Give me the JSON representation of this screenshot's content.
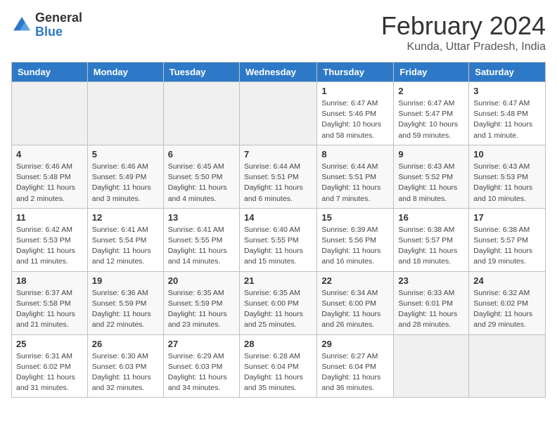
{
  "logo": {
    "general": "General",
    "blue": "Blue"
  },
  "header": {
    "month_year": "February 2024",
    "location": "Kunda, Uttar Pradesh, India"
  },
  "days_of_week": [
    "Sunday",
    "Monday",
    "Tuesday",
    "Wednesday",
    "Thursday",
    "Friday",
    "Saturday"
  ],
  "weeks": [
    [
      {
        "day": "",
        "info": ""
      },
      {
        "day": "",
        "info": ""
      },
      {
        "day": "",
        "info": ""
      },
      {
        "day": "",
        "info": ""
      },
      {
        "day": "1",
        "info": "Sunrise: 6:47 AM\nSunset: 5:46 PM\nDaylight: 10 hours and 58 minutes."
      },
      {
        "day": "2",
        "info": "Sunrise: 6:47 AM\nSunset: 5:47 PM\nDaylight: 10 hours and 59 minutes."
      },
      {
        "day": "3",
        "info": "Sunrise: 6:47 AM\nSunset: 5:48 PM\nDaylight: 11 hours and 1 minute."
      }
    ],
    [
      {
        "day": "4",
        "info": "Sunrise: 6:46 AM\nSunset: 5:48 PM\nDaylight: 11 hours and 2 minutes."
      },
      {
        "day": "5",
        "info": "Sunrise: 6:46 AM\nSunset: 5:49 PM\nDaylight: 11 hours and 3 minutes."
      },
      {
        "day": "6",
        "info": "Sunrise: 6:45 AM\nSunset: 5:50 PM\nDaylight: 11 hours and 4 minutes."
      },
      {
        "day": "7",
        "info": "Sunrise: 6:44 AM\nSunset: 5:51 PM\nDaylight: 11 hours and 6 minutes."
      },
      {
        "day": "8",
        "info": "Sunrise: 6:44 AM\nSunset: 5:51 PM\nDaylight: 11 hours and 7 minutes."
      },
      {
        "day": "9",
        "info": "Sunrise: 6:43 AM\nSunset: 5:52 PM\nDaylight: 11 hours and 8 minutes."
      },
      {
        "day": "10",
        "info": "Sunrise: 6:43 AM\nSunset: 5:53 PM\nDaylight: 11 hours and 10 minutes."
      }
    ],
    [
      {
        "day": "11",
        "info": "Sunrise: 6:42 AM\nSunset: 5:53 PM\nDaylight: 11 hours and 11 minutes."
      },
      {
        "day": "12",
        "info": "Sunrise: 6:41 AM\nSunset: 5:54 PM\nDaylight: 11 hours and 12 minutes."
      },
      {
        "day": "13",
        "info": "Sunrise: 6:41 AM\nSunset: 5:55 PM\nDaylight: 11 hours and 14 minutes."
      },
      {
        "day": "14",
        "info": "Sunrise: 6:40 AM\nSunset: 5:55 PM\nDaylight: 11 hours and 15 minutes."
      },
      {
        "day": "15",
        "info": "Sunrise: 6:39 AM\nSunset: 5:56 PM\nDaylight: 11 hours and 16 minutes."
      },
      {
        "day": "16",
        "info": "Sunrise: 6:38 AM\nSunset: 5:57 PM\nDaylight: 11 hours and 18 minutes."
      },
      {
        "day": "17",
        "info": "Sunrise: 6:38 AM\nSunset: 5:57 PM\nDaylight: 11 hours and 19 minutes."
      }
    ],
    [
      {
        "day": "18",
        "info": "Sunrise: 6:37 AM\nSunset: 5:58 PM\nDaylight: 11 hours and 21 minutes."
      },
      {
        "day": "19",
        "info": "Sunrise: 6:36 AM\nSunset: 5:59 PM\nDaylight: 11 hours and 22 minutes."
      },
      {
        "day": "20",
        "info": "Sunrise: 6:35 AM\nSunset: 5:59 PM\nDaylight: 11 hours and 23 minutes."
      },
      {
        "day": "21",
        "info": "Sunrise: 6:35 AM\nSunset: 6:00 PM\nDaylight: 11 hours and 25 minutes."
      },
      {
        "day": "22",
        "info": "Sunrise: 6:34 AM\nSunset: 6:00 PM\nDaylight: 11 hours and 26 minutes."
      },
      {
        "day": "23",
        "info": "Sunrise: 6:33 AM\nSunset: 6:01 PM\nDaylight: 11 hours and 28 minutes."
      },
      {
        "day": "24",
        "info": "Sunrise: 6:32 AM\nSunset: 6:02 PM\nDaylight: 11 hours and 29 minutes."
      }
    ],
    [
      {
        "day": "25",
        "info": "Sunrise: 6:31 AM\nSunset: 6:02 PM\nDaylight: 11 hours and 31 minutes."
      },
      {
        "day": "26",
        "info": "Sunrise: 6:30 AM\nSunset: 6:03 PM\nDaylight: 11 hours and 32 minutes."
      },
      {
        "day": "27",
        "info": "Sunrise: 6:29 AM\nSunset: 6:03 PM\nDaylight: 11 hours and 34 minutes."
      },
      {
        "day": "28",
        "info": "Sunrise: 6:28 AM\nSunset: 6:04 PM\nDaylight: 11 hours and 35 minutes."
      },
      {
        "day": "29",
        "info": "Sunrise: 6:27 AM\nSunset: 6:04 PM\nDaylight: 11 hours and 36 minutes."
      },
      {
        "day": "",
        "info": ""
      },
      {
        "day": "",
        "info": ""
      }
    ]
  ]
}
